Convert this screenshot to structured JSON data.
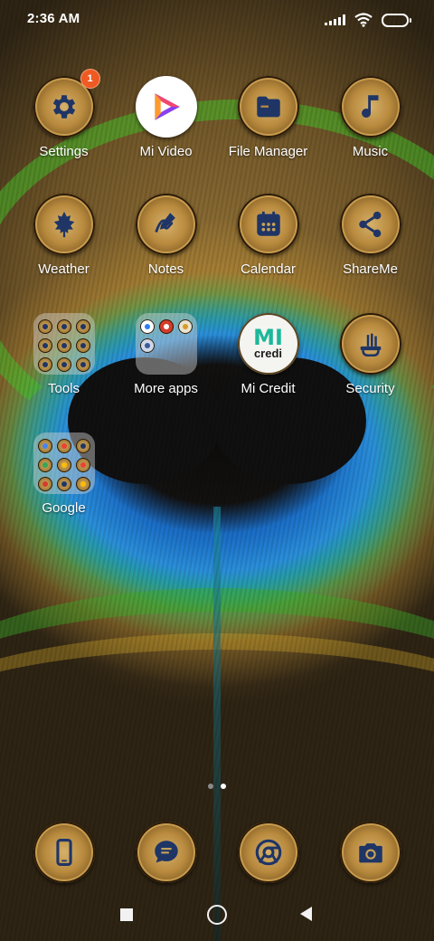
{
  "status_bar": {
    "time": "2:36 AM"
  },
  "apps": [
    {
      "label": "Settings",
      "icon": "gear-icon",
      "badge": "1"
    },
    {
      "label": "Mi Video",
      "icon": "mi-video-logo"
    },
    {
      "label": "File Manager",
      "icon": "folder-icon"
    },
    {
      "label": "Music",
      "icon": "music-note-icon"
    },
    {
      "label": "Weather",
      "icon": "maple-leaf-icon"
    },
    {
      "label": "Notes",
      "icon": "pen-note-icon"
    },
    {
      "label": "Calendar",
      "icon": "calendar-icon"
    },
    {
      "label": "ShareMe",
      "icon": "share-icon"
    },
    {
      "label": "Tools",
      "icon": "folder-icon"
    },
    {
      "label": "More apps",
      "icon": "folder-icon"
    },
    {
      "label": "Mi Credit",
      "icon": "mi-credit-logo",
      "logo_text": "MI",
      "logo_sub": "credi"
    },
    {
      "label": "Security",
      "icon": "security-shield-icon"
    },
    {
      "label": "Google",
      "icon": "folder-icon"
    }
  ],
  "dock": [
    {
      "name": "Phone",
      "icon": "phone-icon"
    },
    {
      "name": "Messages",
      "icon": "message-icon"
    },
    {
      "name": "Chrome",
      "icon": "chrome-icon"
    },
    {
      "name": "Camera",
      "icon": "camera-icon"
    }
  ],
  "colors": {
    "icon_glyph": "#1f3566",
    "badge": "#ef5a22",
    "page_dot_active": "#ffffff",
    "page_dot_inactive": "#8a8a8a"
  },
  "page_indicator": {
    "current": 2,
    "total": 2
  }
}
